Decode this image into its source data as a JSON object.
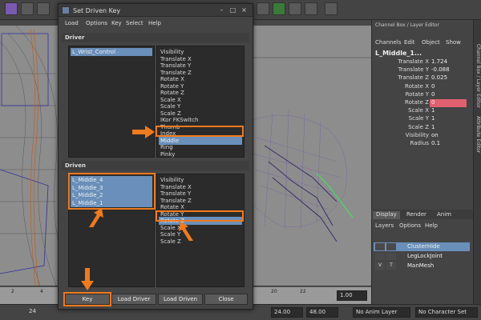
{
  "dialog": {
    "title": "Set Driven Key",
    "menu": [
      "Load",
      "Options",
      "Key",
      "Select",
      "Help"
    ],
    "driver_header": "Driver",
    "driven_header": "Driven",
    "driver_objects": [
      "L_Wrist_Control"
    ],
    "driver_attributes": [
      "Visibility",
      "Translate X",
      "Translate Y",
      "Translate Z",
      "Rotate X",
      "Rotate Y",
      "Rotate Z",
      "Scale X",
      "Scale Y",
      "Scale Z",
      "IKor FKSwitch",
      "Thumb",
      "Index",
      "Middle",
      "Ring",
      "Pinky"
    ],
    "driver_selected_attr": "Middle",
    "driven_objects": [
      "L_Middle_4",
      "L_Middle_3",
      "L_Middle_2",
      "L_Middle_1"
    ],
    "driven_attributes": [
      "Visibility",
      "Translate X",
      "Translate Y",
      "Translate Z",
      "Rotate X",
      "Rotate Y",
      "Rotate Z",
      "Scale X",
      "Scale Y",
      "Scale Z"
    ],
    "driven_selected_attr": "Rotate Z",
    "buttons": {
      "key": "Key",
      "load_driver": "Load Driver",
      "load_driven": "Load Driven",
      "close": "Close"
    }
  },
  "channel_box": {
    "title": "Channel Box / Layer Editor",
    "menu": [
      "Channels",
      "Edit",
      "Object",
      "Show"
    ],
    "node": "L_Middle_1...",
    "channels": [
      {
        "name": "Translate X",
        "value": "1.724"
      },
      {
        "name": "Translate Y",
        "value": "-0.088"
      },
      {
        "name": "Translate Z",
        "value": "0.025"
      },
      {
        "name": "Rotate X",
        "value": "0"
      },
      {
        "name": "Rotate Y",
        "value": "0"
      },
      {
        "name": "Rotate Z",
        "value": "0"
      },
      {
        "name": "Scale X",
        "value": "1"
      },
      {
        "name": "Scale Y",
        "value": "1"
      },
      {
        "name": "Scale Z",
        "value": "1"
      },
      {
        "name": "Visibility",
        "value": "on"
      },
      {
        "name": "Radius",
        "value": "0.1"
      }
    ],
    "side_tabs": [
      "Channel Box / Layer Editor",
      "Attribute Editor"
    ]
  },
  "layer_editor": {
    "tabs": [
      "Display",
      "Render",
      "Anim"
    ],
    "menu": [
      "Layers",
      "Options",
      "Help"
    ],
    "layers": [
      {
        "v": "",
        "t": "",
        "name": "ClusterHide"
      },
      {
        "v": "",
        "t": "",
        "name": "LegLockJoint"
      },
      {
        "v": "V",
        "t": "T",
        "name": "ManMesh"
      }
    ]
  },
  "timeline": {
    "ticks": [
      "2",
      "4",
      "6",
      "8",
      "10",
      "12",
      "14",
      "16",
      "18",
      "20",
      "22"
    ],
    "current_frame": "1.00"
  },
  "bottom": {
    "start": "24",
    "range_start": "24.00",
    "range_end": "48.00",
    "anim_layer": "No Anim Layer",
    "char_set": "No Character Set",
    "frame_field": "24"
  },
  "colors": {
    "highlight": "#f07a1e",
    "selection": "#6a8fba",
    "rotate_z_key": "#e06070"
  }
}
